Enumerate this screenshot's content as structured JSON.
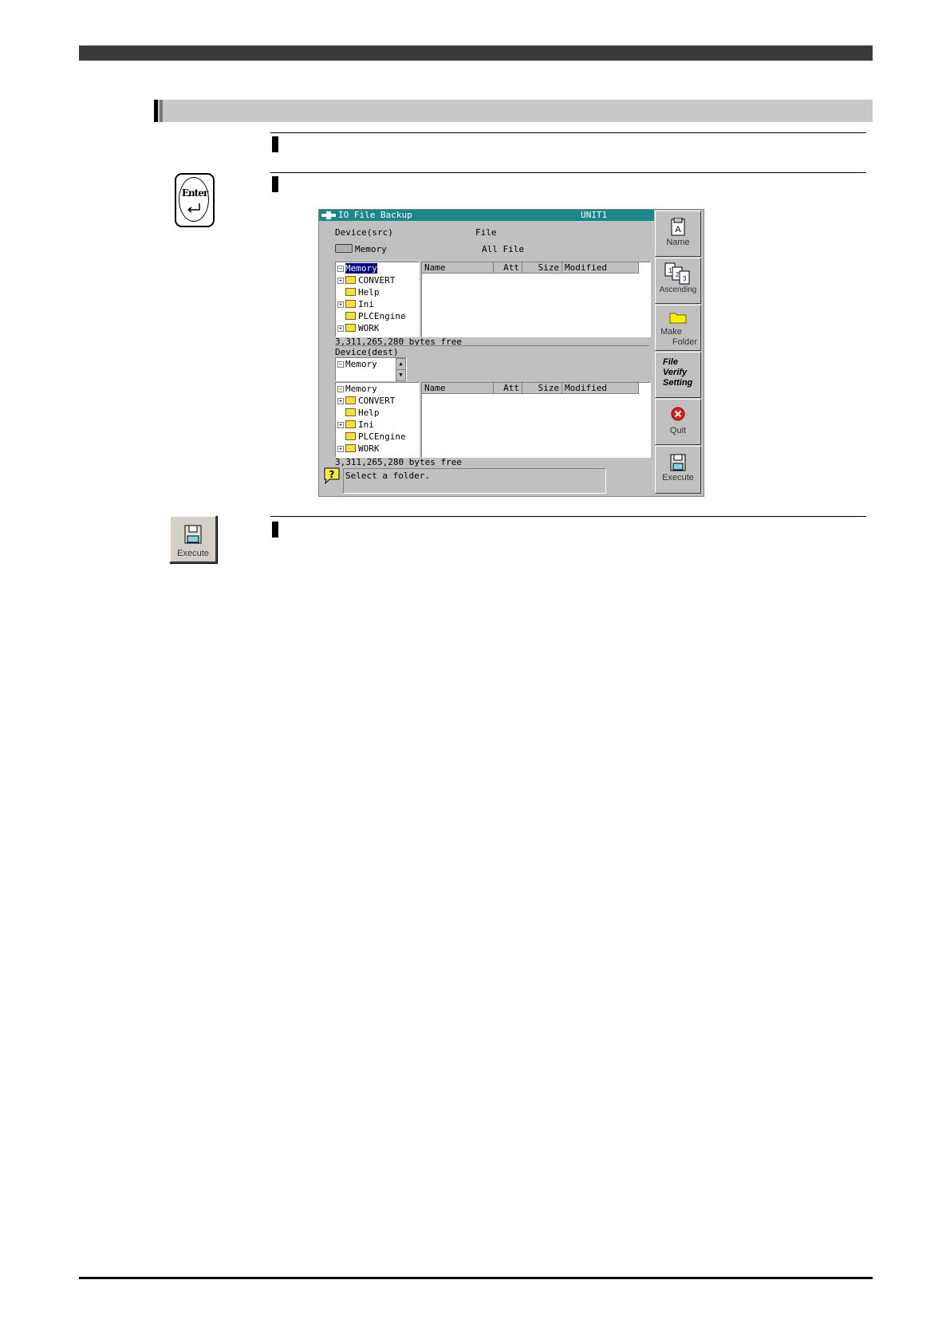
{
  "window": {
    "title": "IO File Backup",
    "unit": "UNIT1",
    "device_src_label": "Device(src)",
    "file_label": "File",
    "src_device": "Memory",
    "file_value": "All File",
    "src_tree": [
      "Memory",
      "CONVERT",
      "Help",
      "Ini",
      "PLCEngine",
      "WORK"
    ],
    "columns": [
      "Name",
      "Att",
      "Size",
      "Modified"
    ],
    "src_free": "3,311,265,280 bytes free",
    "device_dest_label": "Device(dest)",
    "dest_device": "Memory",
    "dest_tree": [
      "Memory",
      "CONVERT",
      "Help",
      "Ini",
      "PLCEngine",
      "WORK"
    ],
    "dest_free": "3,311,265,280 bytes free",
    "message": "Select a folder."
  },
  "side_buttons": {
    "name": "Name",
    "ascending": "Ascending",
    "make_folder_1": "Make",
    "make_folder_2": "Folder",
    "file_verify_1": "File",
    "file_verify_2": "Verify",
    "file_verify_3": "Setting",
    "quit": "Quit",
    "execute": "Execute"
  },
  "enter_key": {
    "label": "Enter"
  },
  "execute_icon": {
    "label": "Execute"
  },
  "icons": [
    "enter-key-icon",
    "disk-icon",
    "folder-icon",
    "quit-icon",
    "help-icon",
    "sort-icon"
  ]
}
